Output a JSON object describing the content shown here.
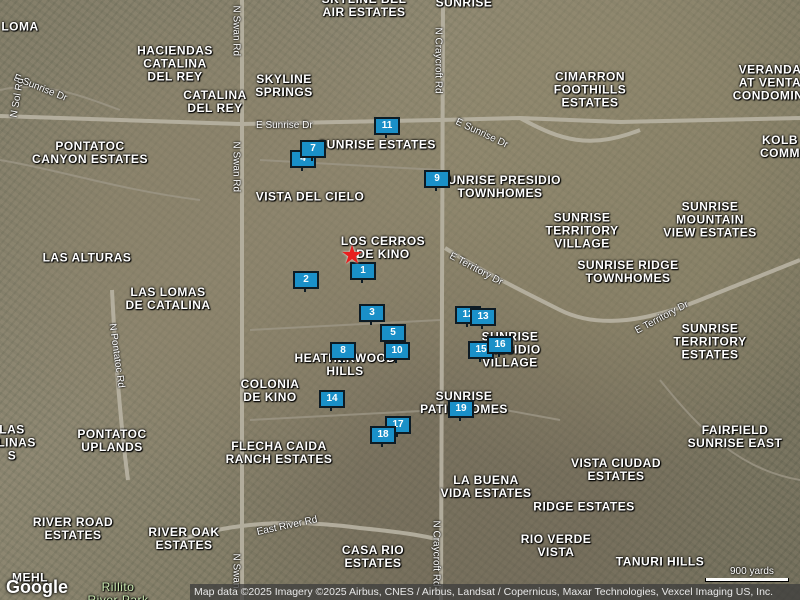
{
  "map": {
    "areas": [
      {
        "id": "loma",
        "text": "LOMA"
      },
      {
        "id": "skyline-bel-air",
        "text": "SKYLINE BEL\nAIR ESTATES"
      },
      {
        "id": "sunrise-top",
        "text": "SUNRISE"
      },
      {
        "id": "haciendas",
        "text": "HACIENDAS\nCATALINA\nDEL REY"
      },
      {
        "id": "catalina-del-rey",
        "text": "CATALINA\nDEL REY"
      },
      {
        "id": "skyline-springs",
        "text": "SKYLINE\nSPRINGS"
      },
      {
        "id": "cimarron",
        "text": "CIMARRON\nFOOTHILLS\nESTATES"
      },
      {
        "id": "veranda",
        "text": "VERANDA\nAT VENTA\nCONDOMINI"
      },
      {
        "id": "kolb",
        "text": "KOLB\nCOMM"
      },
      {
        "id": "pontatoc-canyon",
        "text": "PONTATOC\nCANYON ESTATES"
      },
      {
        "id": "sunrise-estates",
        "text": "SUNRISE ESTATES"
      },
      {
        "id": "sunrise-presidio-th",
        "text": "SUNRISE PRESIDIO\nTOWNHOMES"
      },
      {
        "id": "vista-del-cielo",
        "text": "VISTA DEL CIELO"
      },
      {
        "id": "sunrise-mountain-view",
        "text": "SUNRISE\nMOUNTAIN\nVIEW ESTATES"
      },
      {
        "id": "sunrise-territory-village",
        "text": "SUNRISE\nTERRITORY\nVILLAGE"
      },
      {
        "id": "los-cerros",
        "text": "LOS CERROS\nDE KINO"
      },
      {
        "id": "las-alturas",
        "text": "LAS ALTURAS"
      },
      {
        "id": "sunrise-ridge-th",
        "text": "SUNRISE RIDGE\nTOWNHOMES"
      },
      {
        "id": "las-lomas",
        "text": "LAS LOMAS\nDE CATALINA"
      },
      {
        "id": "sunrise-territory-estates",
        "text": "SUNRISE\nTERRITORY\nESTATES"
      },
      {
        "id": "sunrise-presidio-village",
        "text": "SUNRISE\nPRESIDIO\nVILLAGE"
      },
      {
        "id": "heatherwood",
        "text": "HEATHERWOOD\nHILLS"
      },
      {
        "id": "colonia",
        "text": "COLONIA\nDE KINO"
      },
      {
        "id": "sunrise-patio",
        "text": "SUNRISE\nPATIO HOMES"
      },
      {
        "id": "fairfield",
        "text": "FAIRFIELD\nSUNRISE EAST"
      },
      {
        "id": "las-alinas",
        "text": "LAS\nALINAS\nS"
      },
      {
        "id": "pontatoc-uplands",
        "text": "PONTATOC\nUPLANDS"
      },
      {
        "id": "flecha",
        "text": "FLECHA CAIDA\nRANCH ESTATES"
      },
      {
        "id": "la-buena",
        "text": "LA BUENA\nVIDA ESTATES"
      },
      {
        "id": "vista-ciudad",
        "text": "VISTA CIUDAD\nESTATES"
      },
      {
        "id": "ridge",
        "text": "RIDGE ESTATES"
      },
      {
        "id": "river-road",
        "text": "RIVER ROAD\nESTATES"
      },
      {
        "id": "river-oak",
        "text": "RIVER OAK\nESTATES"
      },
      {
        "id": "rio-verde",
        "text": "RIO VERDE\nVISTA"
      },
      {
        "id": "casa-rio",
        "text": "CASA RIO\nESTATES"
      },
      {
        "id": "tanuri",
        "text": "TANURI HILLS"
      },
      {
        "id": "mehl",
        "text": "MEHL"
      },
      {
        "id": "rillito",
        "text": "Rillito\nRiver Park"
      }
    ],
    "roads": [
      {
        "id": "swan-north",
        "text": "N Swan Rd"
      },
      {
        "id": "craycroft-north",
        "text": "N Craycroft Rd"
      },
      {
        "id": "sunrise-west",
        "text": "E Sunrise Dr"
      },
      {
        "id": "sunrise-mid",
        "text": "E Sunrise Dr"
      },
      {
        "id": "sunrise-east",
        "text": "E Sunrise Dr"
      },
      {
        "id": "sol-rd",
        "text": "N Sol Rd"
      },
      {
        "id": "swan-mid",
        "text": "N Swan Rd"
      },
      {
        "id": "territory-1",
        "text": "E Territory Dr"
      },
      {
        "id": "territory-2",
        "text": "E Territory Dr"
      },
      {
        "id": "pontatoc-rd",
        "text": "N Pontatoc Rd"
      },
      {
        "id": "river-rd",
        "text": "East River Rd"
      },
      {
        "id": "swan-south",
        "text": "N Swan"
      },
      {
        "id": "craycroft-south",
        "text": "N Craycroft Rd"
      }
    ],
    "markers": [
      "1",
      "2",
      "3",
      "4",
      "5",
      "7",
      "8",
      "9",
      "10",
      "11",
      "12",
      "13",
      "14",
      "15",
      "16",
      "17",
      "18",
      "19"
    ],
    "google_logo": "Google",
    "attribution": "Map data ©2025 Imagery ©2025 Airbus, CNES / Airbus, Landsat / Copernicus, Maxar Technologies, Vexcel Imaging US, Inc.",
    "scale_label": "900 yards",
    "colors": {
      "marker": "#1a90c8",
      "star": "#e81f1f"
    }
  }
}
